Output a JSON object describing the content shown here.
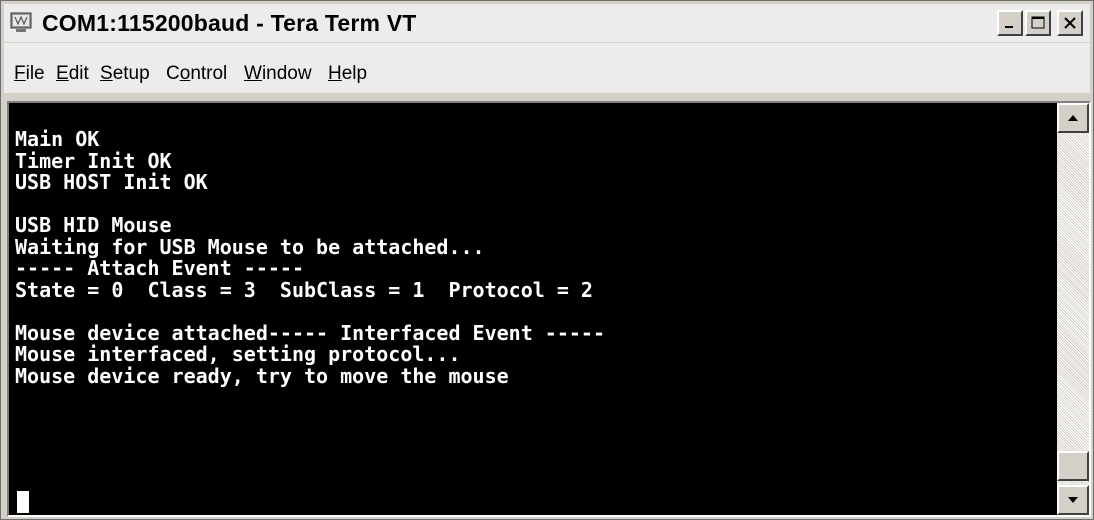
{
  "window": {
    "title": "COM1:115200baud - Tera Term VT"
  },
  "icons": {
    "app": "tera-term-icon",
    "minimize": "minimize-icon",
    "maximize": "maximize-icon",
    "close": "close-icon",
    "scroll_up": "arrow-up-icon",
    "scroll_down": "arrow-down-icon"
  },
  "menu": [
    {
      "label": "File",
      "accel": "F",
      "rest": "ile"
    },
    {
      "label": "Edit",
      "accel": "E",
      "rest": "dit"
    },
    {
      "label": "Setup",
      "accel": "S",
      "rest": "etup"
    },
    {
      "label": "Control",
      "pre": "C",
      "accel": "o",
      "rest": "ntrol"
    },
    {
      "label": "Window",
      "accel": "W",
      "rest": "indow"
    },
    {
      "label": "Help",
      "accel": "H",
      "rest": "elp"
    }
  ],
  "terminal": {
    "lines": [
      "Main OK",
      "Timer Init OK",
      "USB HOST Init OK",
      "",
      "USB HID Mouse",
      "Waiting for USB Mouse to be attached...",
      "----- Attach Event -----",
      "State = 0  Class = 3  SubClass = 1  Protocol = 2",
      "",
      "Mouse device attached----- Interfaced Event -----",
      "Mouse interfaced, setting protocol...",
      "Mouse device ready, try to move the mouse"
    ]
  },
  "colors": {
    "terminal_bg": "#000000",
    "terminal_fg": "#ffffff",
    "chrome": "#d4d0c8"
  }
}
